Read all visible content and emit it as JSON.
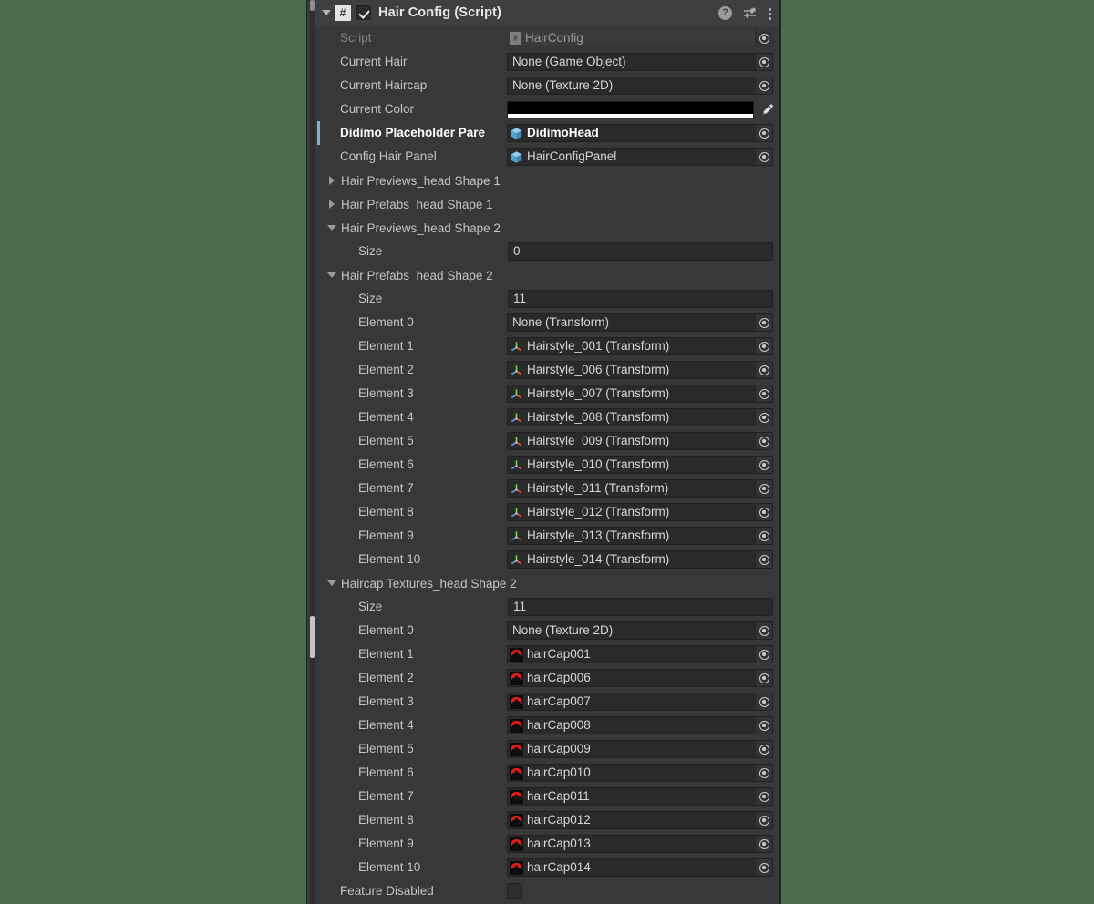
{
  "window": {
    "background_color": "#4d6b4d",
    "panel_color": "#383838"
  },
  "component_header": {
    "title": "Hair Config (Script)",
    "enabled": true,
    "script_icon": "#",
    "foldout_open": true,
    "icons": {
      "help": "help-icon",
      "help_glyph": "?",
      "preset": "preset-icon",
      "menu": "kebab-menu-icon"
    }
  },
  "fields": {
    "script": {
      "label": "Script",
      "value": "HairConfig",
      "icon": "script-icon",
      "disabled": true
    },
    "current_hair": {
      "label": "Current Hair",
      "value": "None (Game Object)",
      "icon": "none-object-icon"
    },
    "current_haircap": {
      "label": "Current Haircap",
      "value": "None (Texture 2D)",
      "icon": "none-texture-icon"
    },
    "current_color": {
      "label": "Current Color",
      "value": "#000000",
      "alpha_color": "#ffffff",
      "eyedropper": "eyedropper-icon"
    },
    "didimo_placeholder_parent": {
      "label": "Didimo Placeholder Pare",
      "value": "DidimoHead",
      "icon": "prefab-icon",
      "overridden": true
    },
    "config_hair_panel": {
      "label": "Config Hair Panel",
      "value": "HairConfigPanel",
      "icon": "prefab-icon"
    },
    "feature_disabled": {
      "label": "Feature Disabled",
      "checked": false
    }
  },
  "foldouts": [
    {
      "label": "Hair Previews_head Shape 1",
      "open": false
    },
    {
      "label": "Hair Prefabs_head Shape 1",
      "open": false
    }
  ],
  "arrays": [
    {
      "id": "hair-previews-head-shape-2",
      "label": "Hair Previews_head Shape 2",
      "open": true,
      "size_label": "Size",
      "size_value": "0",
      "elements": []
    },
    {
      "id": "hair-prefabs-head-shape-2",
      "label": "Hair Prefabs_head Shape 2",
      "open": true,
      "size_label": "Size",
      "size_value": "11",
      "elements": [
        {
          "label": "Element 0",
          "value": "None (Transform)",
          "icon": "none-transform-icon"
        },
        {
          "label": "Element 1",
          "value": "Hairstyle_001 (Transform)",
          "icon": "transform-icon"
        },
        {
          "label": "Element 2",
          "value": "Hairstyle_006 (Transform)",
          "icon": "transform-icon"
        },
        {
          "label": "Element 3",
          "value": "Hairstyle_007 (Transform)",
          "icon": "transform-icon"
        },
        {
          "label": "Element 4",
          "value": "Hairstyle_008 (Transform)",
          "icon": "transform-icon"
        },
        {
          "label": "Element 5",
          "value": "Hairstyle_009 (Transform)",
          "icon": "transform-icon"
        },
        {
          "label": "Element 6",
          "value": "Hairstyle_010 (Transform)",
          "icon": "transform-icon"
        },
        {
          "label": "Element 7",
          "value": "Hairstyle_011 (Transform)",
          "icon": "transform-icon"
        },
        {
          "label": "Element 8",
          "value": "Hairstyle_012 (Transform)",
          "icon": "transform-icon"
        },
        {
          "label": "Element 9",
          "value": "Hairstyle_013 (Transform)",
          "icon": "transform-icon"
        },
        {
          "label": "Element 10",
          "value": "Hairstyle_014 (Transform)",
          "icon": "transform-icon"
        }
      ]
    },
    {
      "id": "haircap-textures-head-shape-2",
      "label": "Haircap Textures_head Shape 2",
      "open": true,
      "size_label": "Size",
      "size_value": "11",
      "elements": [
        {
          "label": "Element 0",
          "value": "None (Texture 2D)",
          "icon": "none-texture-icon"
        },
        {
          "label": "Element 1",
          "value": "hairCap001",
          "icon": "haircap-texture-icon"
        },
        {
          "label": "Element 2",
          "value": "hairCap006",
          "icon": "haircap-texture-icon"
        },
        {
          "label": "Element 3",
          "value": "hairCap007",
          "icon": "haircap-texture-icon"
        },
        {
          "label": "Element 4",
          "value": "hairCap008",
          "icon": "haircap-texture-icon"
        },
        {
          "label": "Element 5",
          "value": "hairCap009",
          "icon": "haircap-texture-icon"
        },
        {
          "label": "Element 6",
          "value": "hairCap010",
          "icon": "haircap-texture-icon"
        },
        {
          "label": "Element 7",
          "value": "hairCap011",
          "icon": "haircap-texture-icon"
        },
        {
          "label": "Element 8",
          "value": "hairCap012",
          "icon": "haircap-texture-icon"
        },
        {
          "label": "Element 9",
          "value": "hairCap013",
          "icon": "haircap-texture-icon"
        },
        {
          "label": "Element 10",
          "value": "hairCap014",
          "icon": "haircap-texture-icon"
        }
      ]
    }
  ]
}
